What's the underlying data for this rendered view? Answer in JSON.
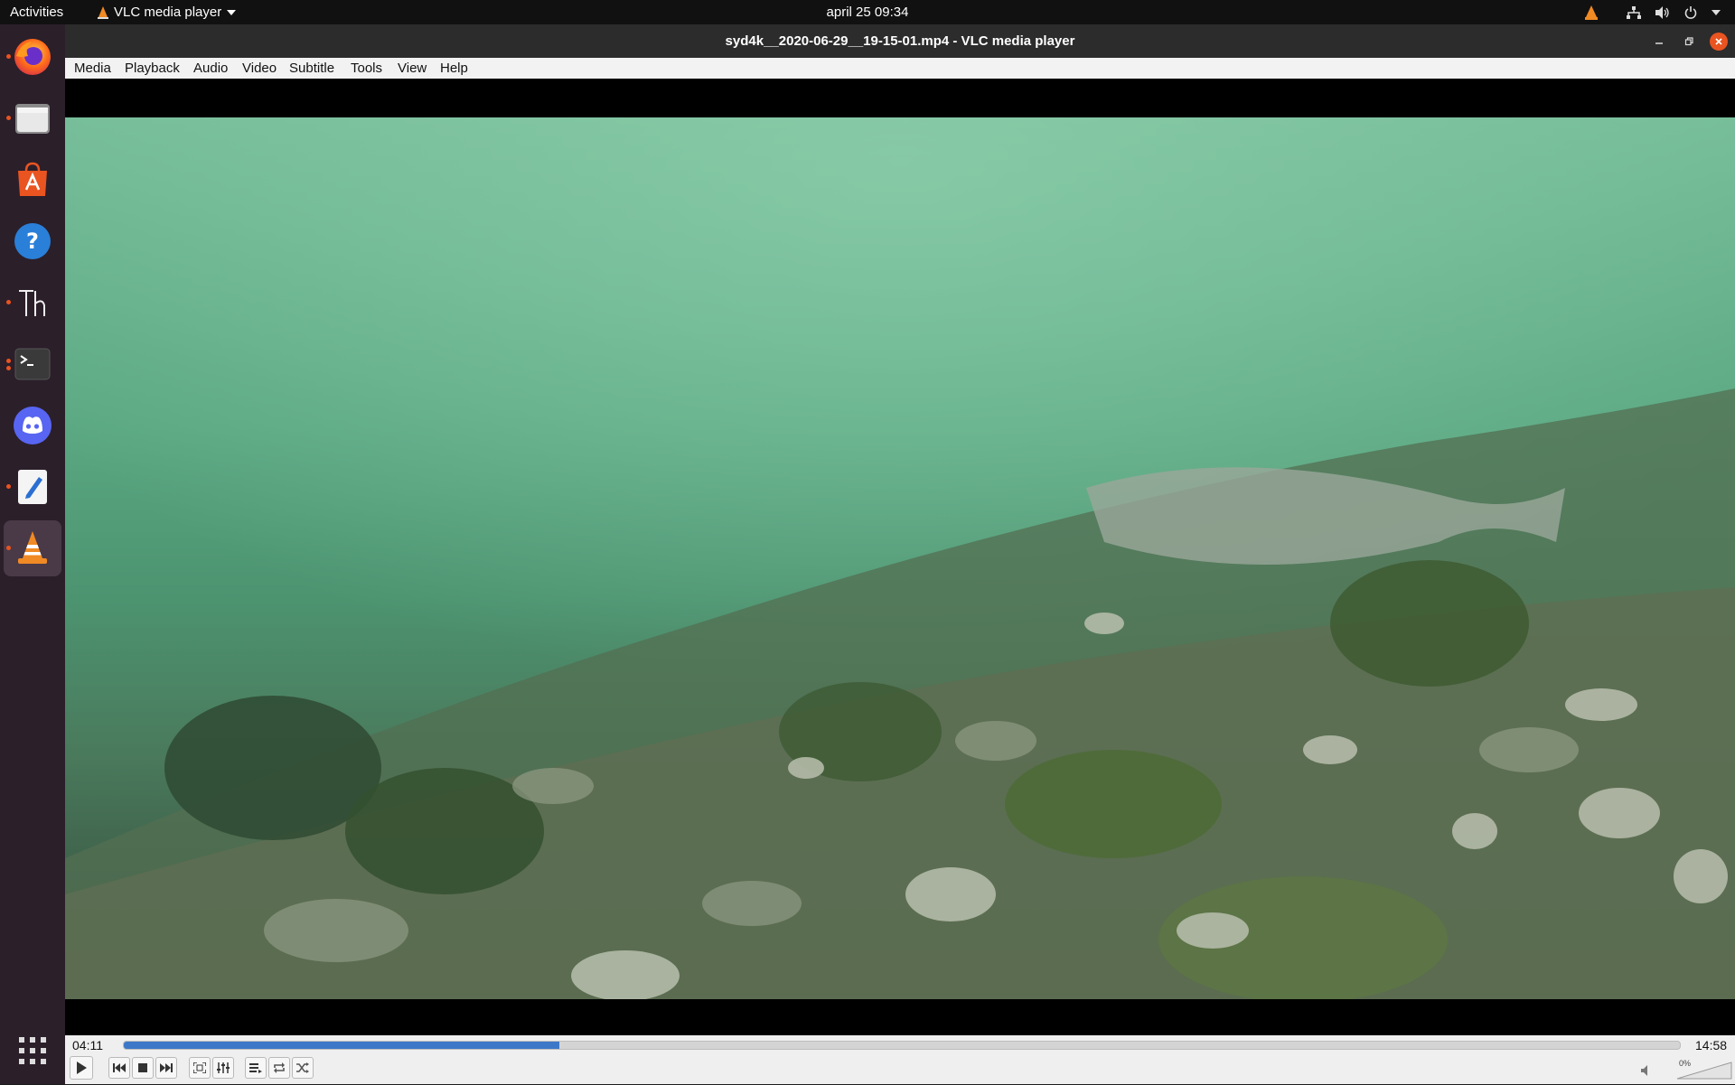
{
  "topbar": {
    "activities": "Activities",
    "app_name": "VLC media player",
    "clock": "april 25  09:34",
    "icons": [
      "vlc-tray-icon",
      "network-icon",
      "volume-icon",
      "power-icon",
      "chevron-down-icon"
    ]
  },
  "dock": {
    "items": [
      {
        "name": "firefox-icon",
        "running": true
      },
      {
        "name": "files-icon",
        "running": true
      },
      {
        "name": "software-center-icon",
        "running": false
      },
      {
        "name": "help-icon",
        "running": false
      },
      {
        "name": "thonny-icon",
        "running": true
      },
      {
        "name": "terminal-icon",
        "running": true
      },
      {
        "name": "discord-icon",
        "running": false
      },
      {
        "name": "text-editor-icon",
        "running": true
      },
      {
        "name": "vlc-icon",
        "running": true,
        "active": true
      }
    ],
    "apps_grid": "show-applications-icon"
  },
  "window": {
    "title": "syd4k__2020-06-29__19-15-01.mp4 - VLC media player",
    "accent": "#e95420"
  },
  "menubar": {
    "items": [
      "Media",
      "Playback",
      "Audio",
      "Video",
      "Subtitle",
      "Tools",
      "View",
      "Help"
    ]
  },
  "controls": {
    "elapsed": "04:11",
    "total": "14:58",
    "progress": 0.28,
    "progress_color": "#3d78c8",
    "volume_label": "0%",
    "buttons": [
      "play-icon",
      "previous-icon",
      "stop-icon",
      "next-icon",
      "fullscreen-icon",
      "extended-settings-icon",
      "playlist-icon",
      "loop-icon",
      "shuffle-icon"
    ]
  }
}
